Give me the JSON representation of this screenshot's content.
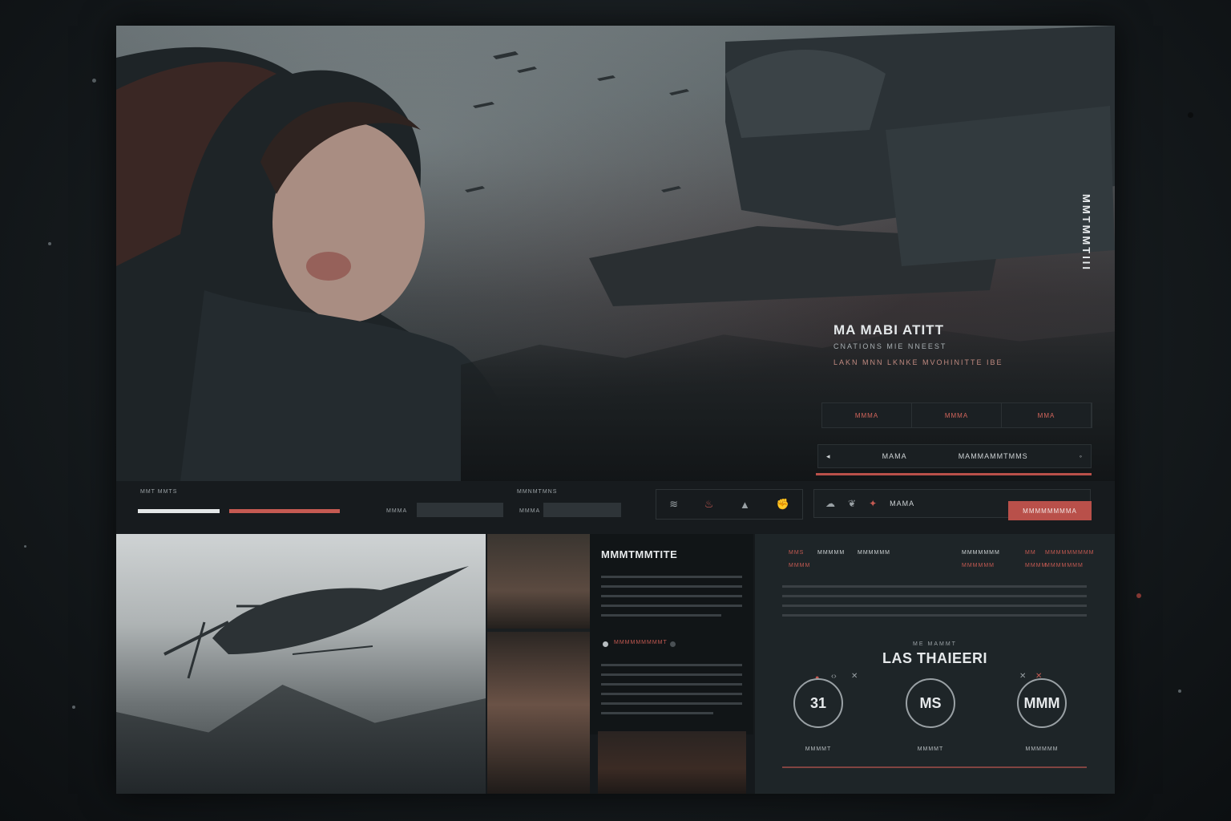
{
  "hero": {
    "title": "MA MABI ATITT",
    "subtitle": "CNATIONS MIE NNEEST",
    "subtitle2": "LAKN MNN LKNKE MVOHINITTE IBE",
    "vertical_label": "MMTMMTIII",
    "tabs": [
      "MMMA",
      "MMMA",
      "MMA"
    ],
    "select": {
      "left": "MAMA",
      "value": "MAMMAMMTMMS",
      "icon": "chevron-icon"
    }
  },
  "controls": {
    "label1": "MMT MMTS",
    "label2": "MMNMTMNS",
    "label3": "MMMA",
    "label4": "MMMA",
    "icons": [
      "wave-icon",
      "flame-icon",
      "alert-icon",
      "fist-icon"
    ],
    "search_icons": [
      "fire-icon",
      "leaf-icon",
      "pin-icon"
    ],
    "search_value": "MAMA",
    "cta": "MMMMMMMMA"
  },
  "article": {
    "title": "MMMTMMTITE",
    "tag": "MMMMMMMMMT"
  },
  "panel": {
    "menu": [
      "MMS",
      "MMMMM",
      "MMMMMM",
      "MMMMMMM",
      "MM",
      "MMMMMMMMM"
    ],
    "submenu": [
      "MMMM",
      "MMMMMM",
      "MMMM",
      "MMMMMMM"
    ],
    "kicker": "ME MAMMT",
    "title": "LAS THAIEERI",
    "stats": [
      {
        "value": "31",
        "caption": "MMMMT"
      },
      {
        "value": "MS",
        "caption": "MMMMT"
      },
      {
        "value": "MMM",
        "caption": "MMMMMM"
      }
    ]
  },
  "colors": {
    "accent": "#b9504a",
    "bg": "#15191c",
    "panel": "#1e2528"
  }
}
